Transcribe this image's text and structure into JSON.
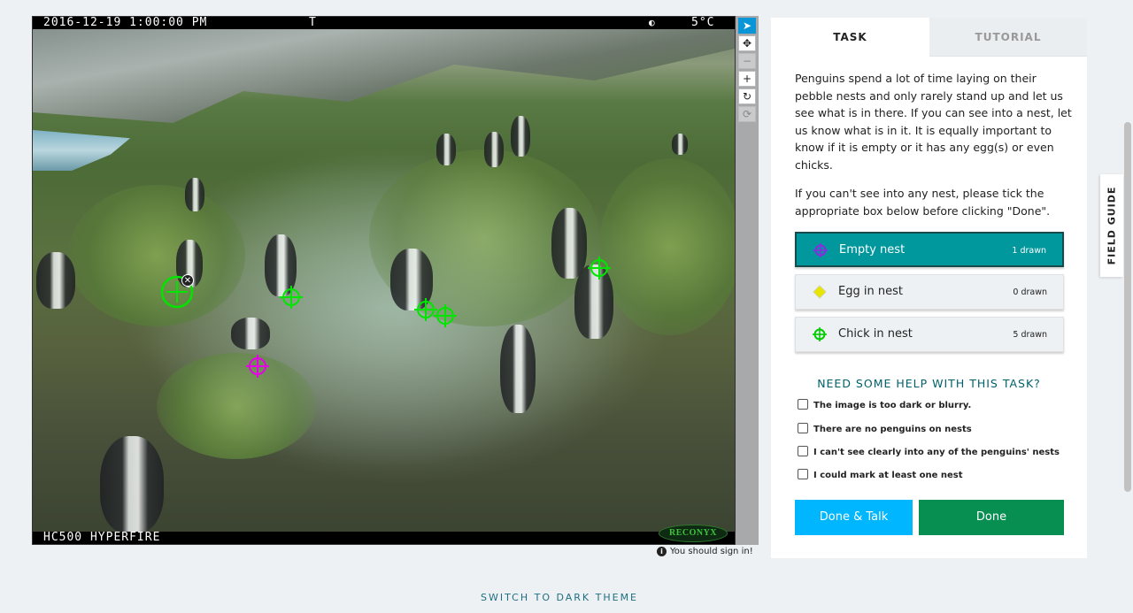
{
  "camera": {
    "timestamp": "2016-12-19 1:00:00 PM",
    "flag": "T",
    "moon_icon": "moon-phase-icon",
    "temperature": "5°C",
    "model": "HC500 HYPERFIRE",
    "brand": "RECONYX"
  },
  "toolbar": {
    "tools": [
      {
        "name": "pointer-tool",
        "icon": "cursor-icon"
      },
      {
        "name": "move-tool",
        "icon": "move-arrows-icon"
      },
      {
        "name": "zoom-out-tool",
        "icon": "minus-icon"
      },
      {
        "name": "zoom-in-tool",
        "icon": "plus-icon"
      },
      {
        "name": "rotate-tool",
        "icon": "rotate-icon"
      },
      {
        "name": "reset-tool",
        "icon": "refresh-icon"
      }
    ]
  },
  "signin_notice": "You should sign in!",
  "tabs": {
    "task": "TASK",
    "tutorial": "TUTORIAL"
  },
  "instructions": {
    "paragraph1": "Penguins spend a lot of time laying on their pebble nests and only rarely stand up and let us see what is in there. If you can see into a nest, let us know what is in it. It is equally important to know if it is empty or it has any egg(s) or even chicks.",
    "paragraph2": "If you can't see into any nest, please tick the appropriate box below before clicking \"Done\"."
  },
  "choices": [
    {
      "label": "Empty nest",
      "count": "1 drawn",
      "color": "#8a2be2",
      "active": true
    },
    {
      "label": "Egg in nest",
      "count": "0 drawn",
      "color": "#e6e600",
      "active": false
    },
    {
      "label": "Chick in nest",
      "count": "5 drawn",
      "color": "#00cc00",
      "active": false
    }
  ],
  "help": {
    "title": "NEED SOME HELP WITH THIS TASK?",
    "options": [
      "The image is too dark or blurry.",
      "There are no penguins on nests",
      "I can't see clearly into any of the penguins' nests",
      "I could mark at least one nest"
    ]
  },
  "buttons": {
    "done_talk": "Done & Talk",
    "done": "Done"
  },
  "field_guide": "FIELD GUIDE",
  "theme_switch": "SWITCH TO DARK THEME",
  "colors": {
    "marker_green": "#00e600",
    "marker_magenta": "#e600e6",
    "accent_teal": "#00979d",
    "talk_blue": "#00b6ff",
    "done_green": "#078f52"
  }
}
